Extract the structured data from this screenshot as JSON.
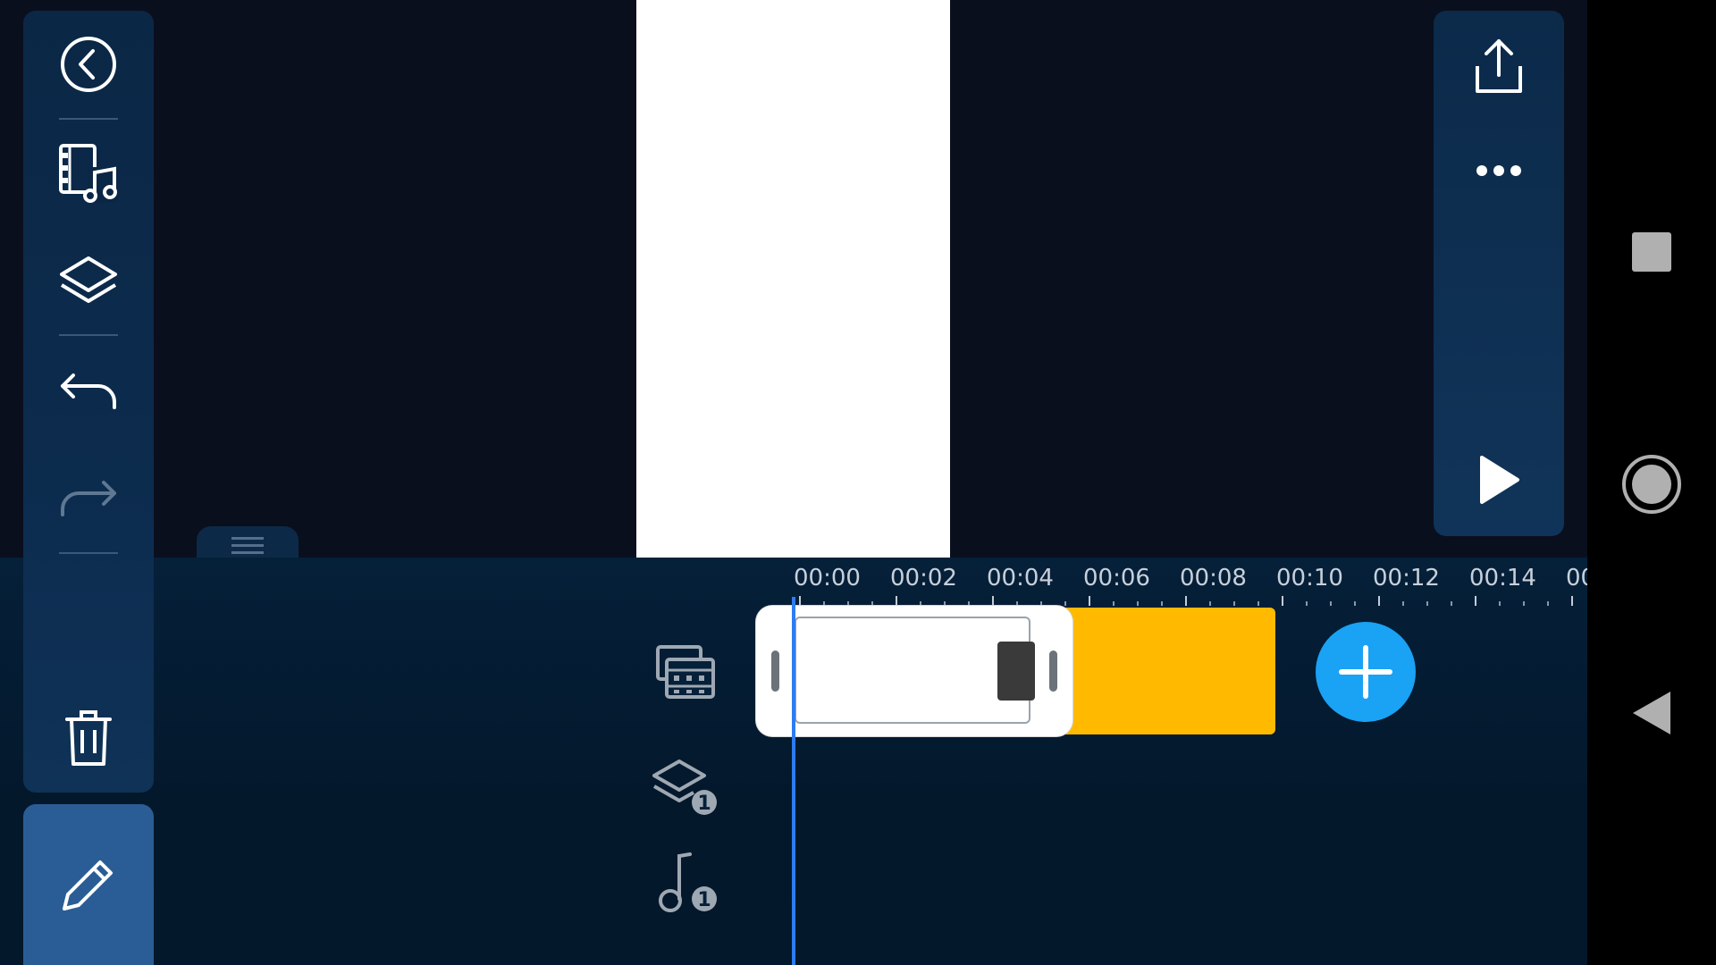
{
  "timeline": {
    "ticks": [
      "00:00",
      "00:02",
      "00:04",
      "00:06",
      "00:08",
      "00:10",
      "00:12",
      "00:14",
      "00"
    ]
  },
  "tracks": {
    "layers_count": "1",
    "audio_count": "1"
  },
  "colors": {
    "accent_blue": "#1aa2f4",
    "clip_yellow": "#ffba00",
    "playhead": "#2d7cf0",
    "edit_tab": "#2a5d95"
  },
  "icons": {
    "left_toolbar": [
      "back-icon",
      "media-music-icon",
      "layers-icon",
      "undo-icon",
      "redo-icon",
      "delete-icon"
    ],
    "edit": "pencil-icon",
    "right_toolbar": [
      "export-icon",
      "more-icon",
      "play-icon"
    ],
    "nav": [
      "recents-icon",
      "home-icon",
      "back-nav-icon"
    ]
  },
  "state": {
    "redo_enabled": false
  }
}
